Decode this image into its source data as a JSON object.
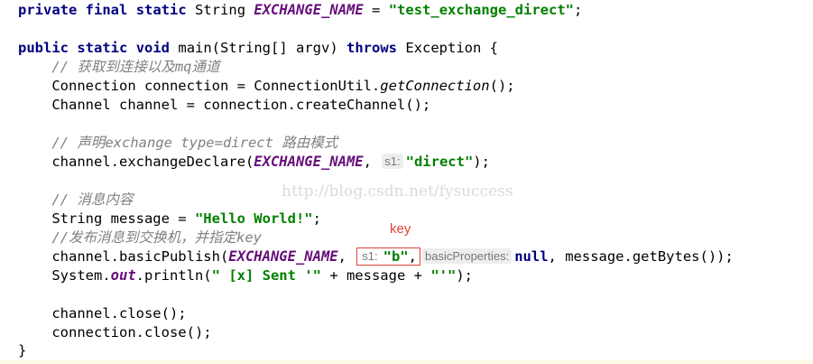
{
  "code": {
    "l1": {
      "k1": "private",
      "k2": "final",
      "k3": "static",
      "t": "String",
      "name": "EXCHANGE_NAME",
      "eq": " = ",
      "val": "\"test_exchange_direct\"",
      "end": ";"
    },
    "l3": {
      "k1": "public",
      "k2": "static",
      "k3": "void",
      "sig": "main(String[] argv) ",
      "kthrows": "throws",
      "rest": " Exception {"
    },
    "l4": {
      "comment": "// 获取到连接以及mq通道"
    },
    "l5": {
      "a": "Connection connection = ConnectionUtil.",
      "m": "getConnection",
      "b": "();"
    },
    "l6": {
      "a": "Channel channel = connection.createChannel();"
    },
    "l8": {
      "comment": "// 声明exchange type=direct 路由模式"
    },
    "l9": {
      "a": "channel.exchangeDeclare(",
      "c": "EXCHANGE_NAME",
      "sep": ", ",
      "hint": "s1:",
      "s": "\"direct\"",
      "end": ");"
    },
    "l11": {
      "comment": "// 消息内容"
    },
    "l12": {
      "a": "String message = ",
      "s": "\"Hello World!\"",
      "end": ";"
    },
    "l13": {
      "comment": "//发布消息到交换机，并指定key"
    },
    "l14": {
      "a": "channel.basicPublish(",
      "c": "EXCHANGE_NAME",
      "sep": ", ",
      "hint1": "s1:",
      "s": "\"b\"",
      "comma": ",",
      "hint2": "basicProperties:",
      "nul": "null",
      "end": ", message.getBytes());"
    },
    "l15": {
      "a": "System.",
      "f": "out",
      "b": ".println(",
      "s1": "\" [x] Sent '\"",
      "c": " + message + ",
      "s2": "\"'\"",
      "end": ");"
    },
    "l17": {
      "a": "channel.close();"
    },
    "l18": {
      "a": "connection.close();"
    },
    "l19": {
      "a": "}"
    }
  },
  "annotation": {
    "key_label": "key"
  },
  "watermark": "http://blog.csdn.net/fysuccess",
  "colors": {
    "keyword": "#000080",
    "constant": "#660e7a",
    "string": "#008000",
    "comment": "#808080",
    "annotation": "#e0423a"
  }
}
